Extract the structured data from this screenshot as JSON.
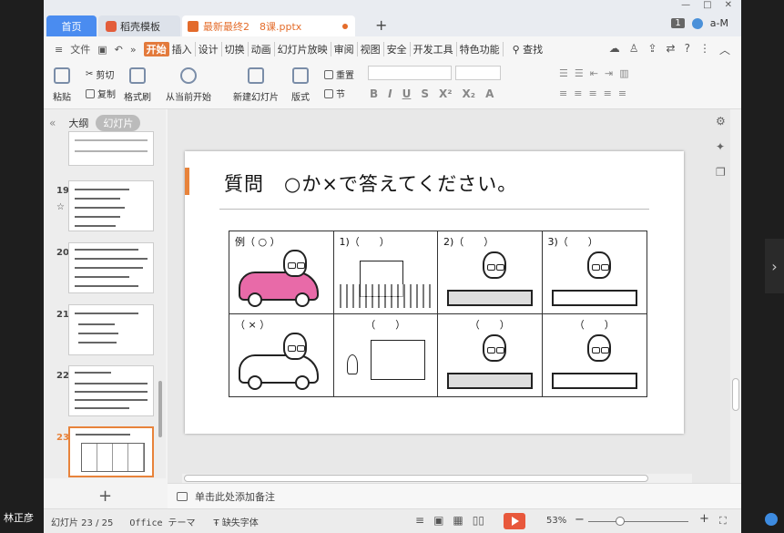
{
  "tabs": {
    "home": "首页",
    "template": "稻壳模板",
    "doc": "最新最终2　8课.pptx"
  },
  "user": {
    "badge": "1",
    "name": "a-M"
  },
  "menu": {
    "file": "文件",
    "items": [
      "开始",
      "插入",
      "设计",
      "切换",
      "动画",
      "幻灯片放映",
      "审阅",
      "视图",
      "安全",
      "开发工具",
      "特色功能"
    ],
    "search": "查找"
  },
  "ribbon": {
    "paste": "粘贴",
    "cut": "剪切",
    "copy": "复制",
    "format_painter": "格式刷",
    "play_from_current": "从当前开始",
    "new_slide": "新建幻灯片",
    "layout": "版式",
    "reset": "重置",
    "section": "节"
  },
  "panel": {
    "outline": "大纲",
    "slides": "幻灯片",
    "thumbs": [
      {
        "num": "19"
      },
      {
        "num": "20"
      },
      {
        "num": "21"
      },
      {
        "num": "22"
      },
      {
        "num": "23"
      }
    ]
  },
  "slide": {
    "title": "質問　○か×で答えてください。",
    "cells": [
      "例（ ○ ）",
      "1)（　　）",
      "2)（　　）",
      "3)（　　）",
      "（ × ）",
      "（　　）",
      "（　　）",
      "（　　）"
    ]
  },
  "notes": {
    "placeholder": "单击此处添加备注"
  },
  "status": {
    "slide_counter": "幻灯片 23 / 25",
    "theme": "Office テーマ",
    "missing_font": "缺失字体",
    "zoom": "53%"
  },
  "overlay": {
    "name": "林正彦"
  },
  "colors": {
    "accent": "#e8833b",
    "tab_active": "#4a8cf0",
    "car_pink": "#e86aa8"
  }
}
